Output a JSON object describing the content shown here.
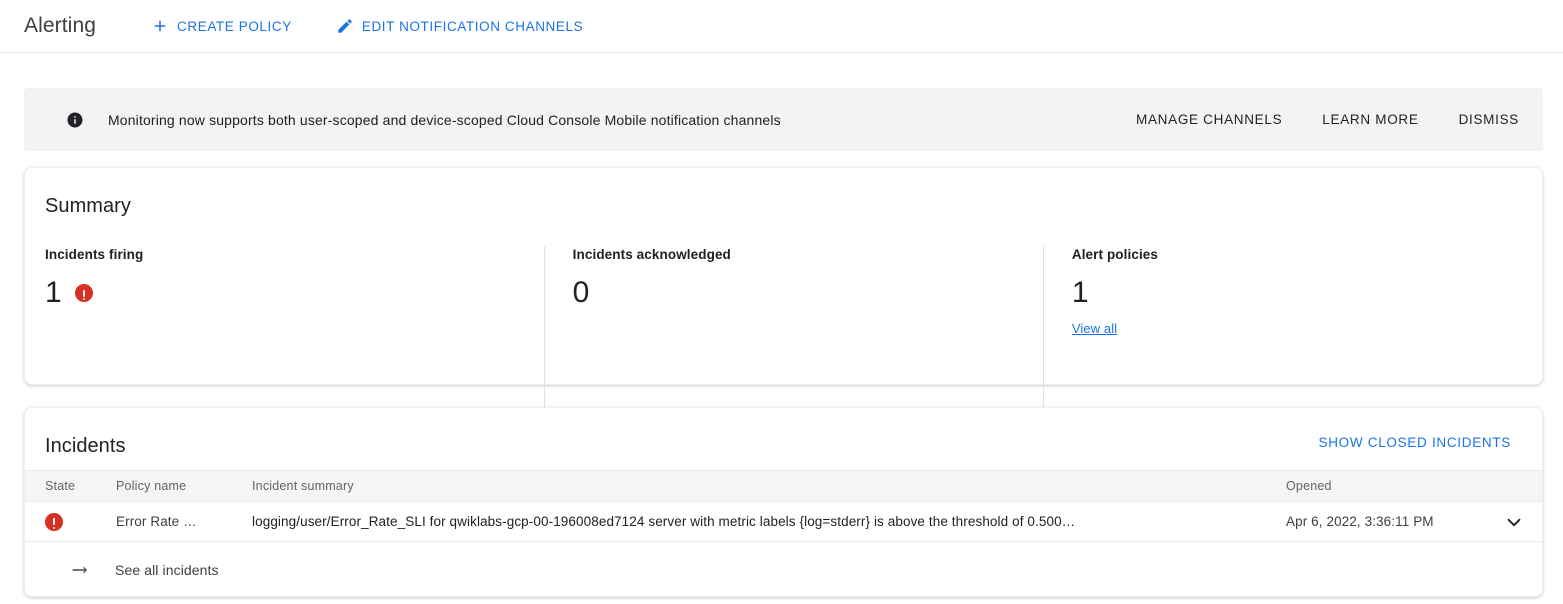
{
  "header": {
    "title": "Alerting",
    "actions": [
      {
        "label": "CREATE POLICY",
        "icon": "plus-icon"
      },
      {
        "label": "EDIT NOTIFICATION CHANNELS",
        "icon": "pencil-icon"
      }
    ]
  },
  "banner": {
    "icon": "info-icon",
    "message": "Monitoring now supports both user-scoped and device-scoped Cloud Console Mobile notification channels",
    "actions": [
      {
        "label": "MANAGE CHANNELS"
      },
      {
        "label": "LEARN MORE"
      },
      {
        "label": "DISMISS"
      }
    ]
  },
  "summary": {
    "title": "Summary",
    "columns": [
      {
        "label": "Incidents firing",
        "value": "1",
        "status_icon": "error-icon",
        "link": null
      },
      {
        "label": "Incidents acknowledged",
        "value": "0",
        "status_icon": null,
        "link": null
      },
      {
        "label": "Alert policies",
        "value": "1",
        "status_icon": null,
        "link": "View all"
      }
    ]
  },
  "incidents": {
    "title": "Incidents",
    "show_closed_label": "SHOW CLOSED INCIDENTS",
    "columns": [
      "State",
      "Policy name",
      "Incident summary",
      "Opened",
      ""
    ],
    "rows": [
      {
        "state_icon": "error-icon",
        "policy_name": "Error Rate …",
        "summary": "logging/user/Error_Rate_SLI for qwiklabs-gcp-00-196008ed7124 server with metric labels {log=stderr} is above the threshold of 0.500…",
        "opened": "Apr 6, 2022, 3:36:11 PM",
        "expand_icon": "chevron-down-icon"
      }
    ],
    "footer": {
      "label": "See all incidents",
      "icon": "arrow-right-icon"
    }
  },
  "colors": {
    "accent_blue": "#1a73e8",
    "error_red": "#d93025",
    "banner_bg": "#f1f3f4",
    "table_header_bg": "#f5f5f5",
    "text_primary": "#202124",
    "text_secondary": "#5f6368"
  }
}
